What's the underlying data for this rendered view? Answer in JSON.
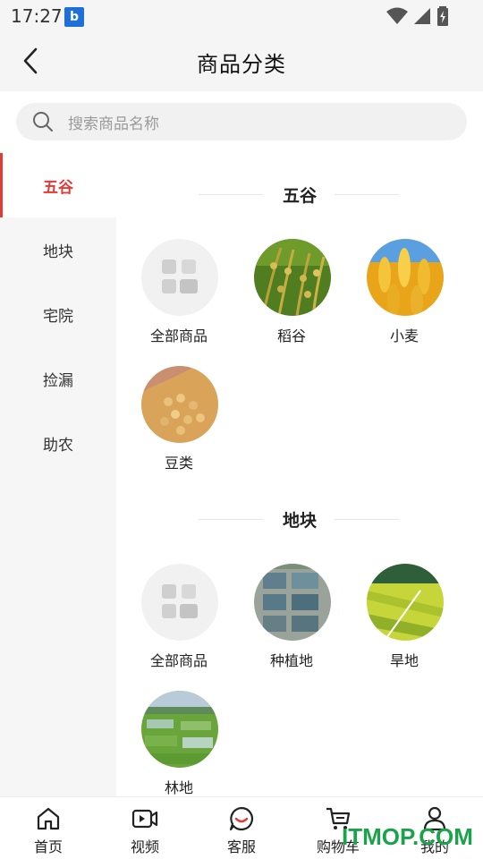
{
  "status_bar": {
    "time": "17:27",
    "app_badge": "b"
  },
  "header": {
    "title": "商品分类"
  },
  "search": {
    "placeholder": "搜索商品名称"
  },
  "sidebar": {
    "items": [
      {
        "label": "五谷",
        "active": true
      },
      {
        "label": "地块",
        "active": false
      },
      {
        "label": "宅院",
        "active": false
      },
      {
        "label": "捡漏",
        "active": false
      },
      {
        "label": "助农",
        "active": false
      }
    ]
  },
  "sections": [
    {
      "title": "五谷",
      "items": [
        {
          "label": "全部商品",
          "icon": "grid-icon"
        },
        {
          "label": "稻谷",
          "icon": "rice-image"
        },
        {
          "label": "小麦",
          "icon": "wheat-image"
        },
        {
          "label": "豆类",
          "icon": "beans-image"
        }
      ]
    },
    {
      "title": "地块",
      "items": [
        {
          "label": "全部商品",
          "icon": "grid-icon"
        },
        {
          "label": "种植地",
          "icon": "ponds-image"
        },
        {
          "label": "旱地",
          "icon": "dryland-image"
        },
        {
          "label": "林地",
          "icon": "fields-image"
        }
      ]
    }
  ],
  "bottom_nav": {
    "items": [
      {
        "label": "首页",
        "icon": "home-icon"
      },
      {
        "label": "视频",
        "icon": "video-icon"
      },
      {
        "label": "客服",
        "icon": "chat-icon"
      },
      {
        "label": "购物车",
        "icon": "cart-icon"
      },
      {
        "label": "我的",
        "icon": "user-icon"
      }
    ]
  },
  "watermark": "ITMOP.COM",
  "colors": {
    "accent": "#e53935",
    "sidebar_bg": "#f6f6f6",
    "watermark": "#1aa34a"
  }
}
